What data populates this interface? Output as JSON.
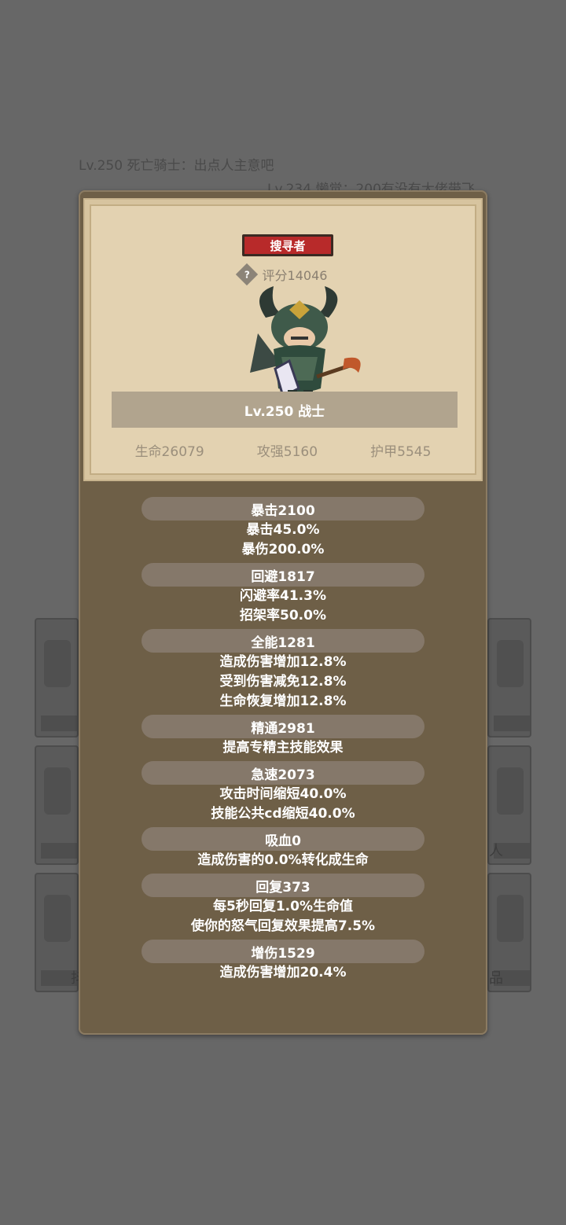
{
  "chat": [
    {
      "text": "Lv.250 死亡骑士：出点人主意吧"
    },
    {
      "text": "Lv.234 懒觉：200有没有大佬带飞"
    }
  ],
  "background_tiles": {
    "left": [
      "",
      "",
      "抖"
    ],
    "right": [
      "",
      "人",
      "品"
    ]
  },
  "card": {
    "role_badge": "搜寻者",
    "help_icon": "?",
    "score": "评分14046",
    "name": "Lv.250 战士",
    "hp": "生命26079",
    "attack": "攻强5160",
    "armor": "护甲5545"
  },
  "stats": [
    {
      "header": "暴击2100",
      "lines": [
        "暴击45.0%",
        "暴伤200.0%"
      ]
    },
    {
      "header": "回避1817",
      "lines": [
        "闪避率41.3%",
        "招架率50.0%"
      ]
    },
    {
      "header": "全能1281",
      "lines": [
        "造成伤害增加12.8%",
        "受到伤害减免12.8%",
        "生命恢复增加12.8%"
      ]
    },
    {
      "header": "精通2981",
      "lines": [
        "提高专精主技能效果"
      ]
    },
    {
      "header": "急速2073",
      "lines": [
        "攻击时间缩短40.0%",
        "技能公共cd缩短40.0%"
      ]
    },
    {
      "header": "吸血0",
      "lines": [
        "造成伤害的0.0%转化成生命"
      ]
    },
    {
      "header": "回复373",
      "lines": [
        "每5秒回复1.0%生命值",
        "使你的怒气回复效果提高7.5%"
      ]
    },
    {
      "header": "增伤1529",
      "lines": [
        "造成伤害增加20.4%"
      ]
    }
  ]
}
